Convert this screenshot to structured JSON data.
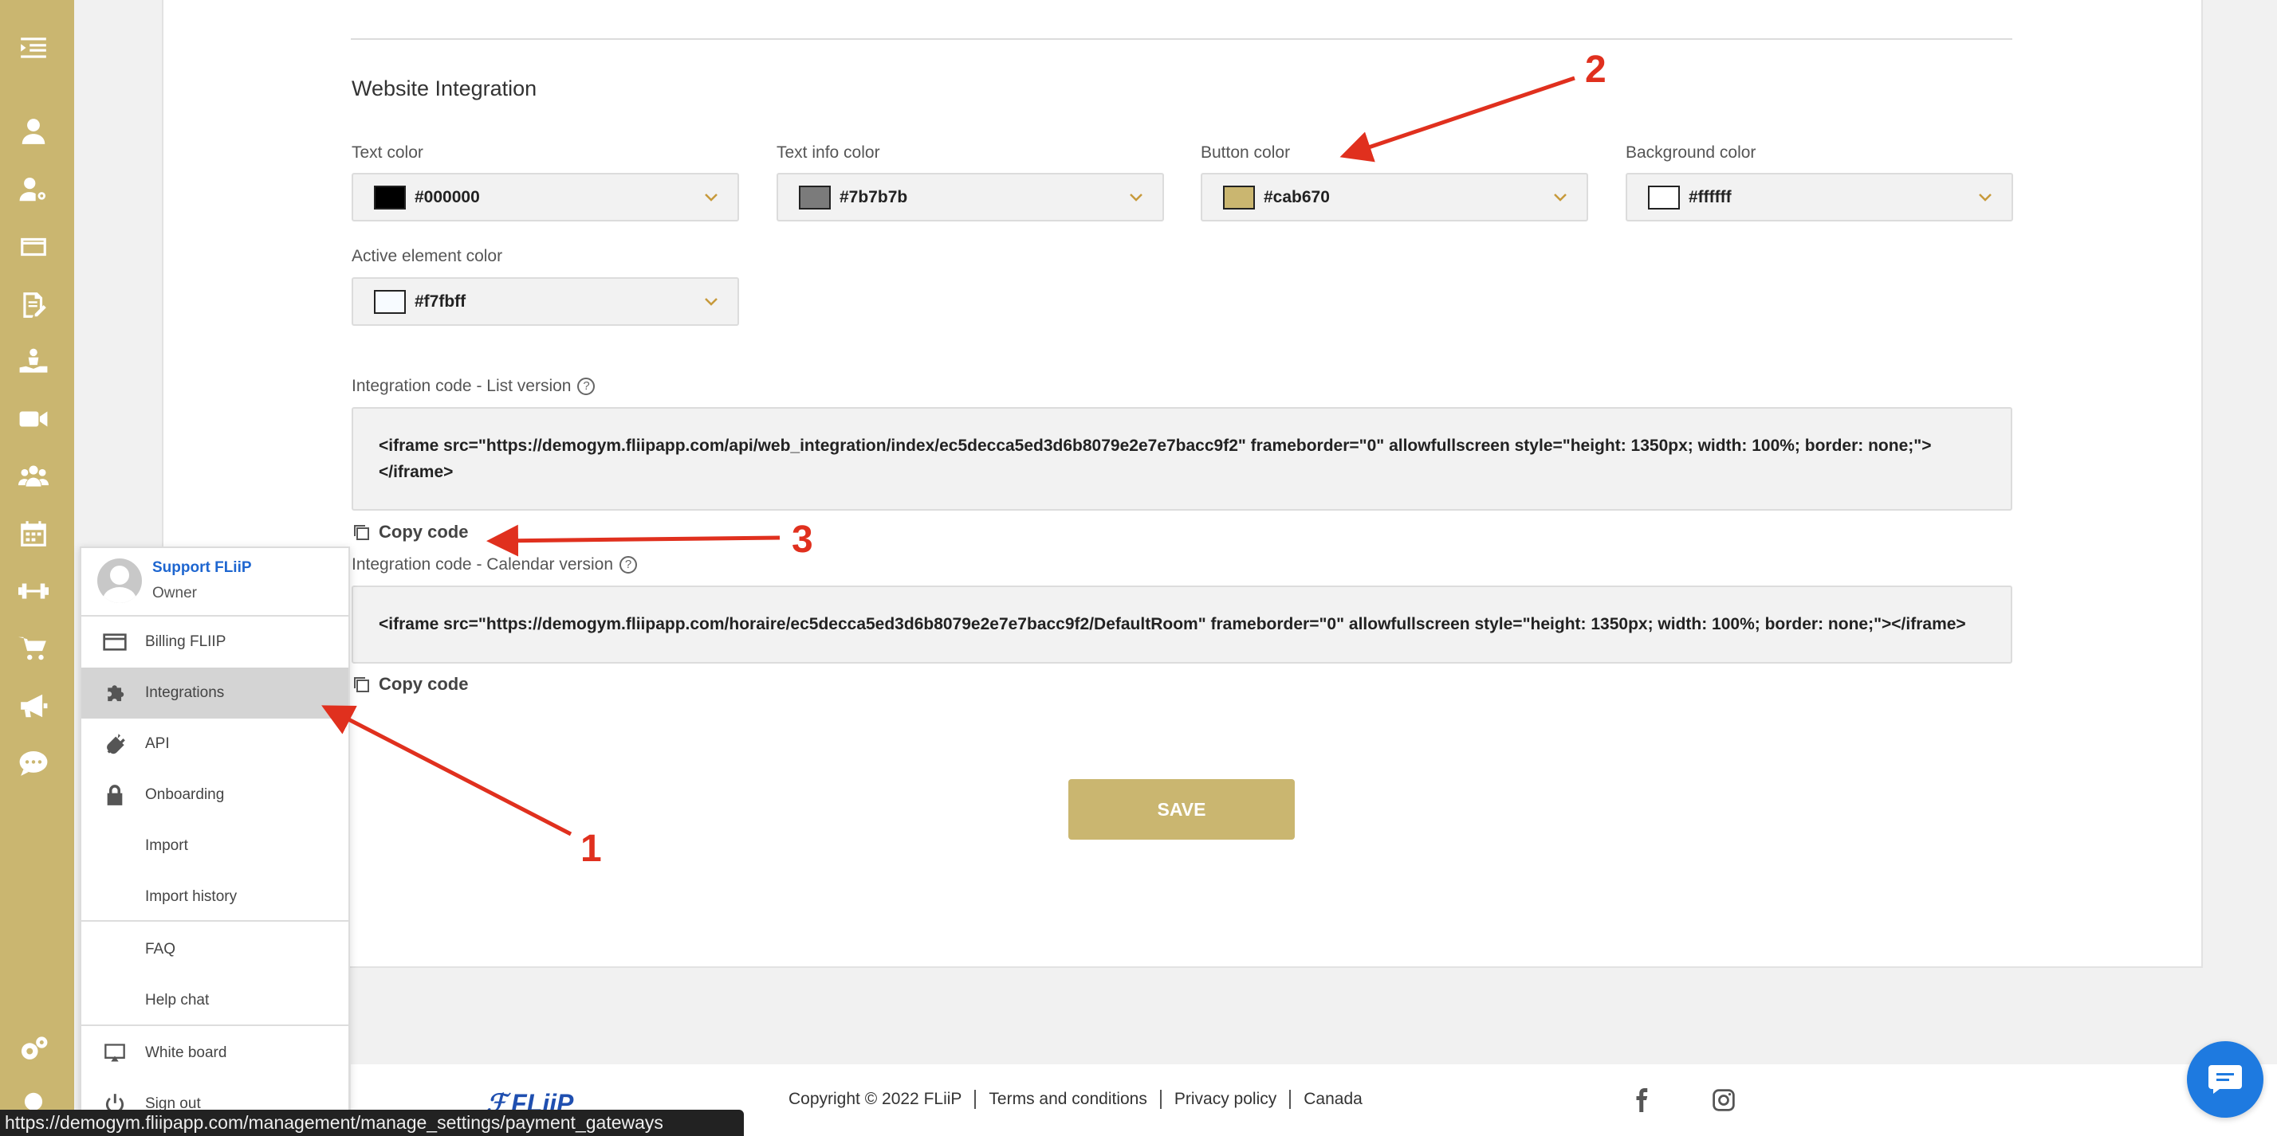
{
  "rail": {
    "icons": [
      "menu-collapse-icon",
      "user-icon",
      "user-settings-icon",
      "credit-card-icon",
      "edit-document-icon",
      "hand-care-icon",
      "video-icon",
      "users-group-icon",
      "calendar-icon",
      "dumbbell-icon",
      "cart-icon",
      "megaphone-icon",
      "chat-icon",
      "settings-icon",
      "lightbulb-icon"
    ],
    "color": "#cab670"
  },
  "section": {
    "title": "Website Integration"
  },
  "colors": {
    "text_label": "Text color",
    "text_value": "#000000",
    "info_label": "Text info color",
    "info_value": "#7b7b7b",
    "button_label": "Button color",
    "button_value": "#cab670",
    "background_label": "Background color",
    "background_value": "#ffffff",
    "active_label": "Active element color",
    "active_value": "#f7fbff"
  },
  "integration": {
    "list_label": "Integration code - List version",
    "list_code": "<iframe src=\"https://demogym.fliipapp.com/api/web_integration/index/ec5decca5ed3d6b8079e2e7e7bacc9f2\" frameborder=\"0\" allowfullscreen style=\"height: 1350px; width: 100%; border: none;\"></iframe>",
    "calendar_label": "Integration code - Calendar version",
    "calendar_code": "<iframe src=\"https://demogym.fliipapp.com/horaire/ec5decca5ed3d6b8079e2e7e7bacc9f2/DefaultRoom\" frameborder=\"0\" allowfullscreen style=\"height: 1350px; width: 100%; border: none;\"></iframe>",
    "copy_label": "Copy code",
    "help_glyph": "?"
  },
  "save_label": "SAVE",
  "menu": {
    "user_name": "Support FLiiP",
    "user_role": "Owner",
    "items": [
      {
        "label": "Billing FLIIP",
        "icon": "credit-card-icon"
      },
      {
        "label": "Integrations",
        "icon": "puzzle-icon"
      },
      {
        "label": "API",
        "icon": "plug-icon"
      },
      {
        "label": "Onboarding",
        "icon": "lock-icon"
      },
      {
        "label": "Import",
        "icon": ""
      },
      {
        "label": "Import history",
        "icon": ""
      },
      {
        "label": "FAQ",
        "icon": ""
      },
      {
        "label": "Help chat",
        "icon": ""
      },
      {
        "label": "White board",
        "icon": "monitor-icon"
      },
      {
        "label": "Sign out",
        "icon": "power-icon"
      }
    ]
  },
  "footer": {
    "logo": "FLiiP",
    "copyright": "Copyright © 2022 FLiiP",
    "terms": "Terms and conditions",
    "privacy": "Privacy policy",
    "country": "Canada"
  },
  "status_url": "https://demogym.fliipapp.com/management/manage_settings/payment_gateways",
  "annotations": [
    "1",
    "2",
    "3"
  ],
  "accent_color": "#cab670",
  "arrow_color": "#e0301e"
}
